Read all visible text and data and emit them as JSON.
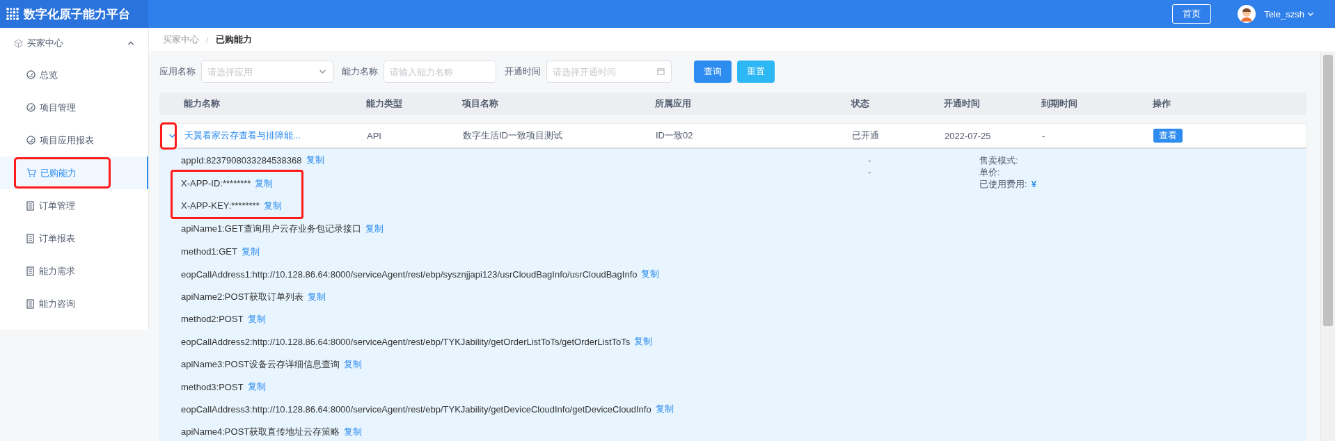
{
  "header": {
    "title": "数字化原子能力平台",
    "home_button": "首页",
    "user": "Tele_szsh"
  },
  "sidebar": {
    "group": {
      "label": "买家中心",
      "expanded": true
    },
    "items": [
      {
        "label": "总览",
        "kind": "dashboard",
        "selected": false,
        "highlighted": false
      },
      {
        "label": "项目管理",
        "kind": "dashboard",
        "selected": false,
        "highlighted": false
      },
      {
        "label": "项目应用报表",
        "kind": "dashboard",
        "selected": false,
        "highlighted": false
      },
      {
        "label": "已购能力",
        "kind": "cart",
        "selected": true,
        "highlighted": true
      },
      {
        "label": "订单管理",
        "kind": "document",
        "selected": false,
        "highlighted": false
      },
      {
        "label": "订单报表",
        "kind": "document",
        "selected": false,
        "highlighted": false
      },
      {
        "label": "能力需求",
        "kind": "document",
        "selected": false,
        "highlighted": false
      },
      {
        "label": "能力咨询",
        "kind": "document",
        "selected": false,
        "highlighted": false
      }
    ]
  },
  "breadcrumb": {
    "items": [
      "买家中心",
      "已购能力"
    ],
    "separator": "/"
  },
  "filters": [
    {
      "label": "应用名称",
      "kind": "select",
      "placeholder": "请选择应用"
    },
    {
      "label": "能力名称",
      "kind": "input",
      "placeholder": "请输入能力名称"
    },
    {
      "label": "开通时间",
      "kind": "date",
      "placeholder": "请选择开通时间"
    }
  ],
  "buttons": [
    {
      "label": "查询",
      "kind": "primary"
    },
    {
      "label": "重置",
      "kind": "info"
    }
  ],
  "table": {
    "columns": [
      "能力名称",
      "能力类型",
      "项目名称",
      "所属应用",
      "状态",
      "开通时间",
      "到期时间",
      "操作"
    ],
    "rows": [
      {
        "expanded": true,
        "toggle_highlighted": true,
        "cells": [
          "天翼看家云存查看与排障能...",
          "API",
          "数字生活ID一致项目测试",
          "ID一致02",
          "已开通",
          "2022-07-25",
          "-"
        ],
        "action": "查看",
        "detail": {
          "rows": [
            {
              "text": "appId:8237908033284538368",
              "copy": "复制",
              "highlighted": false
            },
            {
              "text": "X-APP-ID:********",
              "copy": "复制",
              "highlighted": true
            },
            {
              "text": "X-APP-KEY:********",
              "copy": "复制",
              "highlighted": true
            },
            {
              "text": "apiName1:GET查询用户云存业务包记录接口",
              "copy": "复制",
              "highlighted": false
            },
            {
              "text": "method1:GET",
              "copy": "复制",
              "highlighted": false
            },
            {
              "text": "eopCallAddress1:http://10.128.86.64:8000/serviceAgent/rest/ebp/sysznjjapi123/usrCloudBagInfo/usrCloudBagInfo",
              "copy": "复制",
              "highlighted": false
            },
            {
              "text": "apiName2:POST获取订单列表",
              "copy": "复制",
              "highlighted": false
            },
            {
              "text": "method2:POST",
              "copy": "复制",
              "highlighted": false
            },
            {
              "text": "eopCallAddress2:http://10.128.86.64:8000/serviceAgent/rest/ebp/TYKJability/getOrderListToTs/getOrderListToTs",
              "copy": "复制",
              "highlighted": false
            },
            {
              "text": "apiName3:POST设备云存详细信息查询",
              "copy": "复制",
              "highlighted": false
            },
            {
              "text": "method3:POST",
              "copy": "复制",
              "highlighted": false
            },
            {
              "text": "eopCallAddress3:http://10.128.86.64:8000/serviceAgent/rest/ebp/TYKJability/getDeviceCloudInfo/getDeviceCloudInfo",
              "copy": "复制",
              "highlighted": false
            },
            {
              "text": "apiName4:POST获取直传地址云存策略",
              "copy": "复制",
              "highlighted": false
            }
          ],
          "dashes": [
            "-",
            "-"
          ],
          "info": [
            {
              "label": "售卖模式:"
            },
            {
              "label": "单价:"
            },
            {
              "label": "已使用费用:",
              "value": "¥"
            }
          ]
        }
      }
    ]
  }
}
